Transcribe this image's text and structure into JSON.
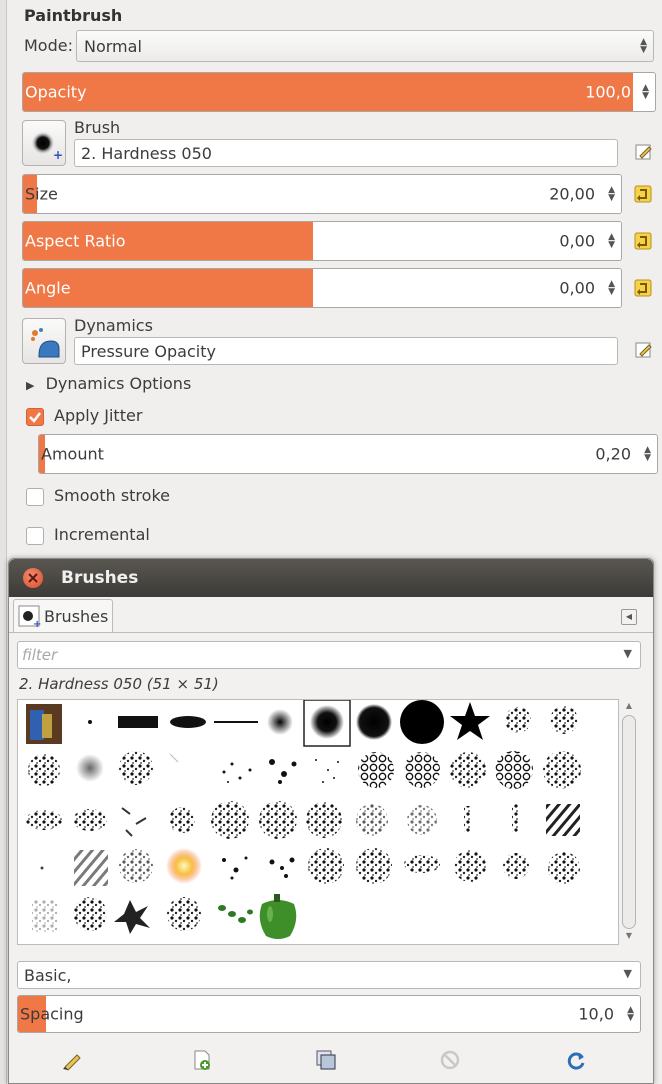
{
  "tool": {
    "title": "Paintbrush",
    "mode_label": "Mode:",
    "mode_value": "Normal",
    "opacity": {
      "label": "Opacity",
      "value": "100,0",
      "fill": 1.0
    },
    "brush": {
      "label": "Brush",
      "value": "2. Hardness 050"
    },
    "size": {
      "label": "Size",
      "value": "20,00",
      "fill": 0.025
    },
    "aspect": {
      "label": "Aspect Ratio",
      "value": "0,00",
      "fill": 0.5
    },
    "angle": {
      "label": "Angle",
      "value": "0,00",
      "fill": 0.5
    },
    "dynamics": {
      "label": "Dynamics",
      "value": "Pressure Opacity"
    },
    "dynamics_options": "Dynamics Options",
    "apply_jitter": {
      "label": "Apply Jitter",
      "checked": true
    },
    "amount": {
      "label": "Amount",
      "value": "0,20",
      "fill": 0.02
    },
    "smooth_stroke": {
      "label": "Smooth stroke",
      "checked": false
    },
    "incremental": {
      "label": "Incremental",
      "checked": false
    }
  },
  "dock": {
    "title": "Brushes",
    "tab_label": "Brushes",
    "filter_placeholder": "filter",
    "selected_brush": "2. Hardness 050 (51 × 51)",
    "tag_value": "Basic,",
    "spacing": {
      "label": "Spacing",
      "value": "10,0",
      "fill": 0.05
    }
  },
  "colors": {
    "accent": "#f07746",
    "titlebar": "#45433f"
  }
}
